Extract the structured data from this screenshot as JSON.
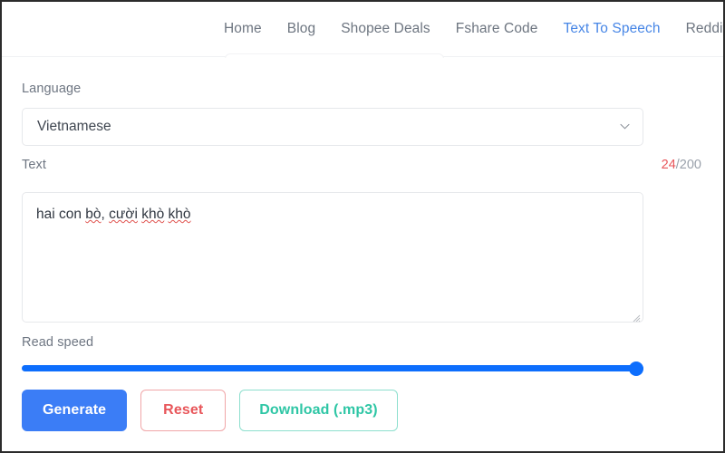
{
  "nav": {
    "items": [
      {
        "label": "Home",
        "active": false
      },
      {
        "label": "Blog",
        "active": false
      },
      {
        "label": "Shopee Deals",
        "active": false
      },
      {
        "label": "Fshare Code",
        "active": false
      },
      {
        "label": "Text To Speech",
        "active": true
      },
      {
        "label": "Reddit",
        "active": false
      }
    ]
  },
  "form": {
    "language_label": "Language",
    "language_value": "Vietnamese",
    "language_chevron_icon": "chevron-down-icon",
    "text_label": "Text",
    "counter_used": "24",
    "counter_max": "/200",
    "text_value": "hai con bò, cười khò khò",
    "text_tokens": [
      {
        "t": "hai con ",
        "spell": false
      },
      {
        "t": "bò",
        "spell": true
      },
      {
        "t": ", ",
        "spell": false
      },
      {
        "t": "cười",
        "spell": true
      },
      {
        "t": " ",
        "spell": false
      },
      {
        "t": "khò",
        "spell": true
      },
      {
        "t": " ",
        "spell": false
      },
      {
        "t": "khò",
        "spell": true
      }
    ],
    "speed_label": "Read speed",
    "speed_percent": 100
  },
  "buttons": {
    "generate": "Generate",
    "reset": "Reset",
    "download": "Download (.mp3)"
  },
  "colors": {
    "accent_blue": "#3b7df6",
    "nav_active": "#4786e6",
    "danger_red": "#e8565a",
    "success_teal": "#2ec6a5",
    "label_gray": "#6e7682",
    "slider_blue": "#0d6efd"
  }
}
